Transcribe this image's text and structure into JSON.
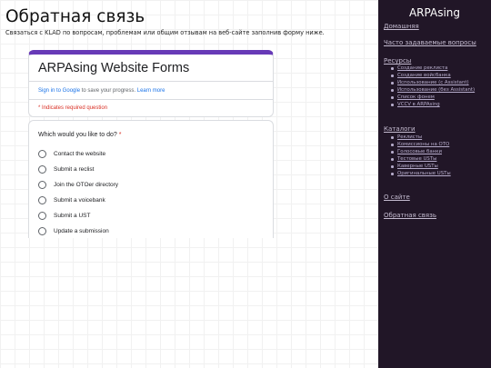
{
  "page": {
    "title": "Обратная связь",
    "subtitle": "Связаться с KLAD по вопросам, проблемам или общим отзывам на веб-сайте заполнив форму ниже."
  },
  "form": {
    "title": "ARPAsing Website Forms",
    "signin_link": "Sign in to Google",
    "signin_text": " to save your progress. ",
    "learn_more": "Learn more",
    "required_note": "* Indicates required question",
    "question": "Which would you like to do?",
    "required_star": "*",
    "options": [
      "Contact the website",
      "Submit a reclist",
      "Join the OTOer directory",
      "Submit a voicebank",
      "Submit a UST",
      "Update a submission"
    ]
  },
  "sidebar": {
    "site_title": "ARPAsing",
    "home": "Домашняя",
    "faq": "Часто задаваемые вопросы",
    "resources_label": "Ресурсы",
    "resources": [
      "Создание реклиста",
      "Создание войсбанка",
      "Использование (с Assistant)",
      "Использование (без Assistant)",
      "Список фонем",
      "VCCV в ARPAsing"
    ],
    "catalogs_label": "Каталоги",
    "catalogs": [
      "Реклисты",
      "Комиссионы на ОТО",
      "Голосовые банки",
      "Тестовые USTы",
      "Каверные USTы",
      "Оригинальные USTы"
    ],
    "about": "О сайте",
    "feedback": "Обратная связь"
  },
  "colors": {
    "accent": "#673ab7",
    "sidebar_bg": "#211627",
    "link": "#1a73e8",
    "required": "#d93025"
  }
}
